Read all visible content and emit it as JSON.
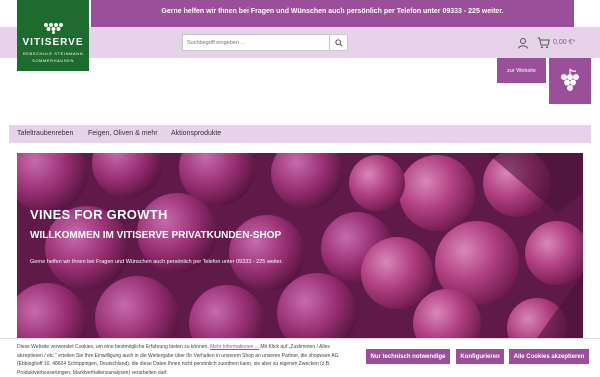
{
  "topbar": {
    "text": "Gerne helfen wir Ihnen bei Fragen und Wünschen auch persönlich per Telefon unter 09333 - 225 weiter."
  },
  "logo": {
    "title": "VITISERVE",
    "line1": "REBSCHULE STEINMANN",
    "line2": "SOMMERHAUSEN"
  },
  "search": {
    "placeholder": "Suchbegriff eingeben ..."
  },
  "cart": {
    "total": "0,00 €*"
  },
  "website_button": "zur Website",
  "nav": {
    "items": [
      "Tafeltraubenreben",
      "Feigen, Oliven & mehr",
      "Aktionsprodukte"
    ]
  },
  "hero": {
    "title": "VINES FOR GROWTH",
    "subtitle": "WILLKOMMEN IM VITISERVE PRIVATKUNDEN-SHOP",
    "text": "Gerne helfen wir Ihnen bei Fragen und Wünschen auch persönlich per Telefon unter 09333 - 225 weiter."
  },
  "cookie": {
    "text_before": "Diese Website verwendet Cookies, um eine bestmögliche Erfahrung bieten zu können.",
    "link": "Mehr Informationen ...",
    "text_after": "Mit Klick auf „Zustimmen / Alles akzeptieren / etc.\" erteilen Sie Ihre Einwilligung auch in die Weitergabe über Ihr Verhalten in unserem Shop an unseren Partner, die shopware AG (Ebbinghoff 10, 48624 Schöppingen, Deutschland), die diese Daten Ihnen nicht persönlich zuordnen kann, sie aber zu eigenen Zwecken (z.B. Produktverbesserungen, Marktverhaltensanalysen) verarbeiten darf.",
    "buttons": [
      "Nur technisch notwendige",
      "Konfigurieren",
      "Alle Cookies akzeptieren"
    ]
  },
  "colors": {
    "brand_purple": "#9b4f9b",
    "brand_green": "#1e6b2e",
    "light_lilac": "#e6d3e9"
  }
}
